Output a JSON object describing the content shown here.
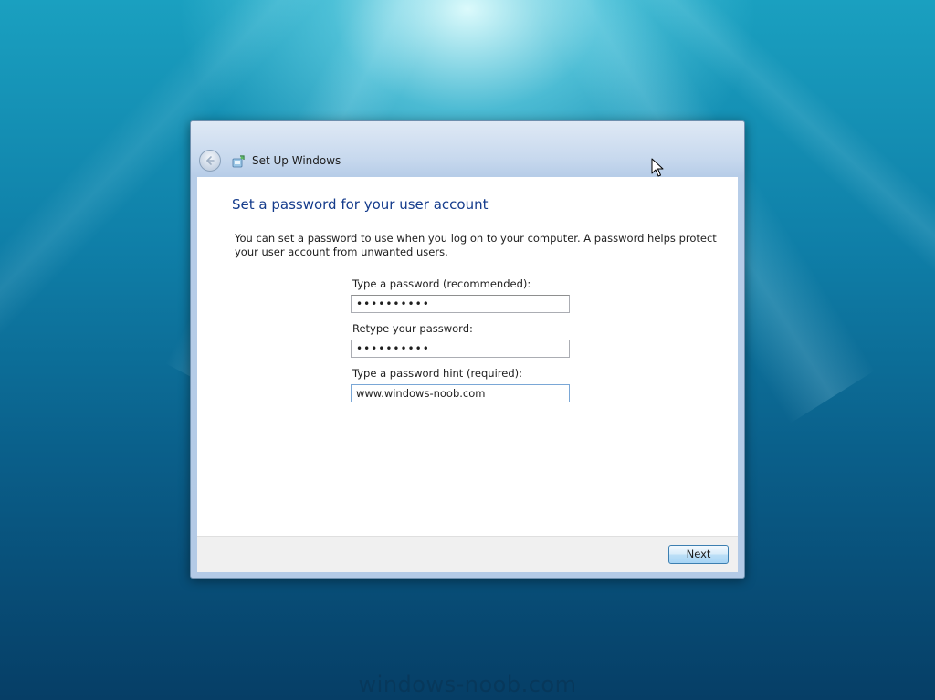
{
  "window": {
    "title": "Set Up Windows"
  },
  "content": {
    "heading": "Set a password for your user account",
    "description": "You can set a password to use when you log on to your computer. A password helps protect your user account from unwanted users.",
    "password_label": "Type a password (recommended):",
    "password_value": "••••••••••",
    "retype_label": "Retype your password:",
    "retype_value": "••••••••••",
    "hint_label": "Type a password hint (required):",
    "hint_value": "www.windows-noob.com"
  },
  "footer": {
    "next_label": "Next"
  },
  "watermark": "windows-noob.com",
  "icons": {
    "back": "back-arrow-icon",
    "app": "setup-windows-icon",
    "cursor": "mouse-pointer-icon"
  },
  "colors": {
    "heading": "#153c8c",
    "button_border": "#3c7fb1"
  }
}
